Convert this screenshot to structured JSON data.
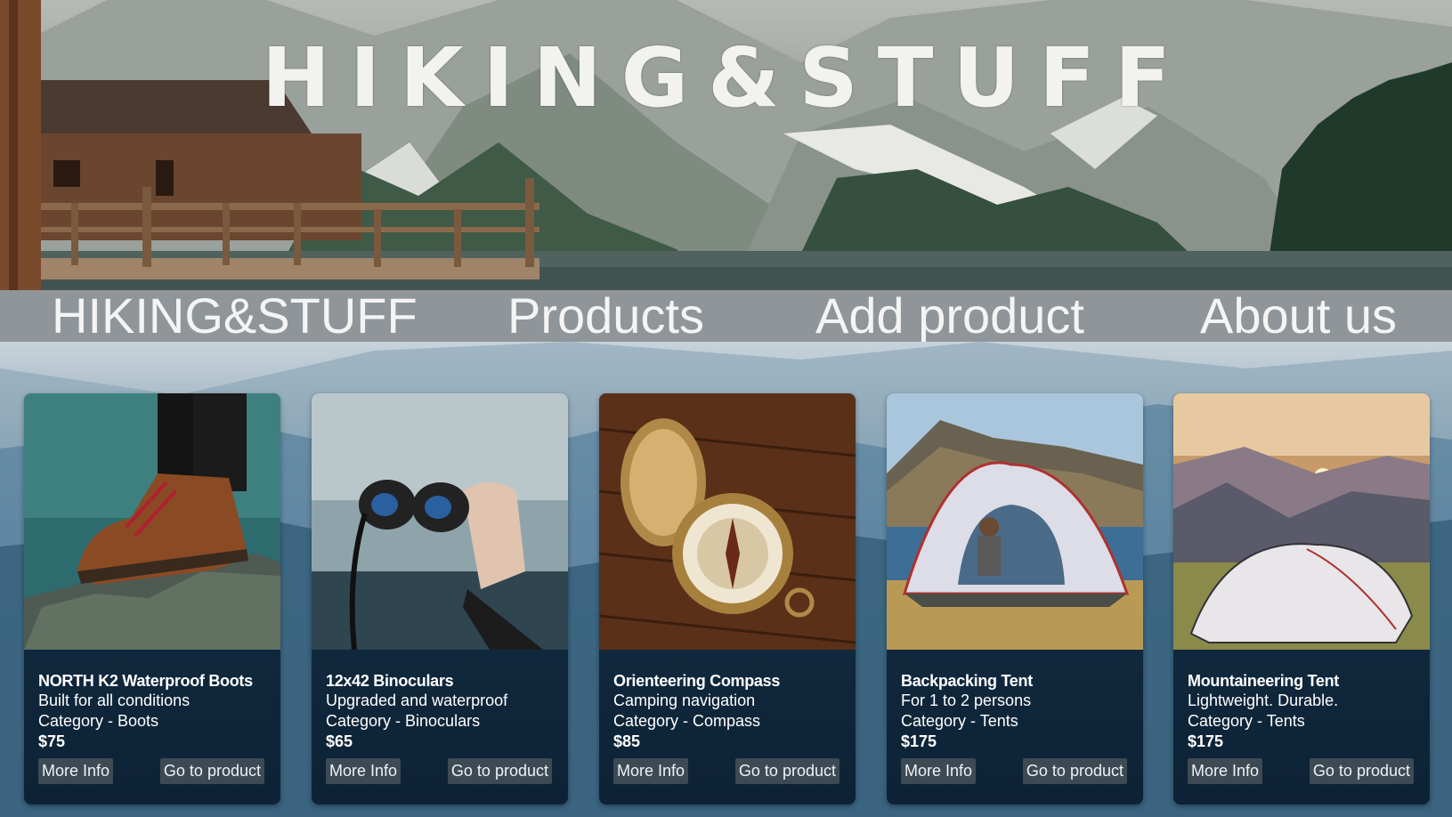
{
  "header": {
    "logo_title": "HIKING&STUFF"
  },
  "nav": {
    "brand": "HIKING&STUFF",
    "products": "Products",
    "add_product": "Add product",
    "about": "About us"
  },
  "products": [
    {
      "name": "NORTH K2 Waterproof Boots",
      "description": "Built for all conditions",
      "category": "Category - Boots",
      "price": "$75",
      "more_label": "More Info",
      "go_label": "Go to product"
    },
    {
      "name": "12x42 Binoculars",
      "description": "Upgraded and waterproof",
      "category": "Category - Binoculars",
      "price": "$65",
      "more_label": "More Info",
      "go_label": "Go to product"
    },
    {
      "name": "Orienteering Compass",
      "description": "Camping navigation",
      "category": "Category - Compass",
      "price": "$85",
      "more_label": "More Info",
      "go_label": "Go to product"
    },
    {
      "name": "Backpacking Tent",
      "description": "For 1 to 2 persons",
      "category": "Category - Tents",
      "price": "$175",
      "more_label": "More Info",
      "go_label": "Go to product"
    },
    {
      "name": "Mountaineering Tent",
      "description": "Lightweight. Durable.",
      "category": "Category - Tents",
      "price": "$175",
      "more_label": "More Info",
      "go_label": "Go to product"
    }
  ],
  "colors": {
    "nav_bg": "#96999a",
    "card_bg": "#0f263a",
    "button_bg": "#3d4a54",
    "text": "#ffffff"
  }
}
